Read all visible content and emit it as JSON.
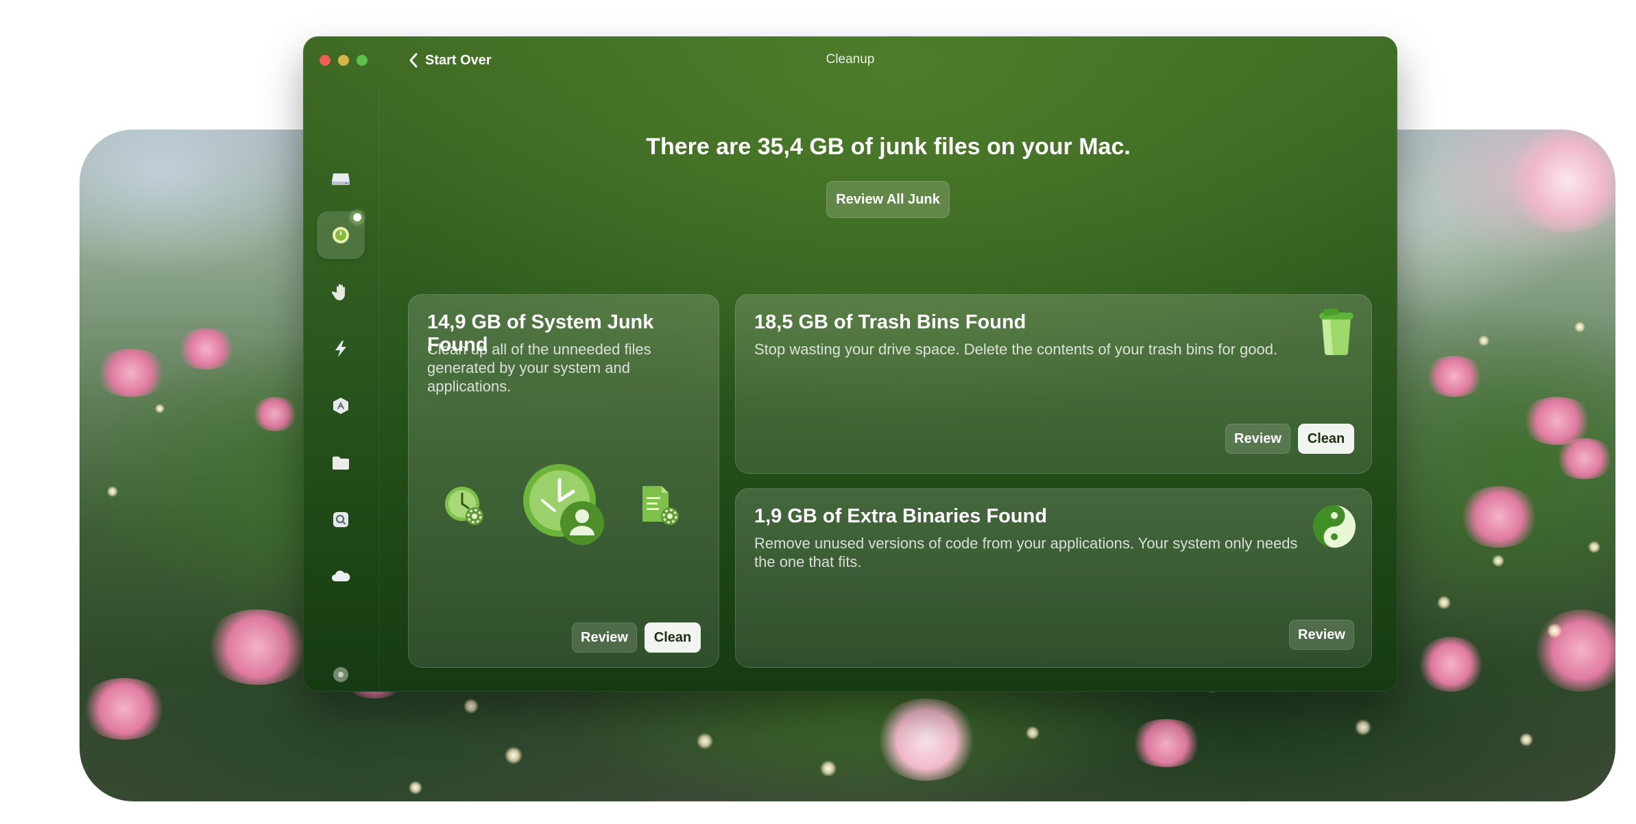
{
  "window": {
    "title": "Cleanup",
    "back_label": "Start Over"
  },
  "sidebar": {
    "items": [
      {
        "name": "sidebar-item-drive",
        "icon": "drive-icon",
        "active": false
      },
      {
        "name": "sidebar-item-cleanup",
        "icon": "cleanup-icon",
        "active": true
      },
      {
        "name": "sidebar-item-protection",
        "icon": "hand-icon",
        "active": false
      },
      {
        "name": "sidebar-item-performance",
        "icon": "lightning-icon",
        "active": false
      },
      {
        "name": "sidebar-item-applications",
        "icon": "apps-icon",
        "active": false
      },
      {
        "name": "sidebar-item-files",
        "icon": "folder-icon",
        "active": false
      },
      {
        "name": "sidebar-item-space-lens",
        "icon": "lens-icon",
        "active": false
      },
      {
        "name": "sidebar-item-cloud",
        "icon": "cloud-icon",
        "active": false
      },
      {
        "name": "sidebar-item-assistant",
        "icon": "assistant-icon",
        "active": false
      }
    ]
  },
  "main": {
    "headline": "There are 35,4 GB of junk files on your Mac.",
    "review_all_label": "Review All Junk",
    "cards": {
      "system_junk": {
        "title": "14,9 GB of System Junk Found",
        "description": "Clean up all of the unneeded files generated by your system and applications.",
        "review_label": "Review",
        "clean_label": "Clean"
      },
      "trash_bins": {
        "title": "18,5 GB of Trash Bins Found",
        "description": "Stop wasting your drive space. Delete the contents of your trash bins for good.",
        "review_label": "Review",
        "clean_label": "Clean"
      },
      "extra_binaries": {
        "title": "1,9 GB of Extra Binaries Found",
        "description": "Remove unused versions of code from your applications. Your system only needs the one that fits.",
        "review_label": "Review"
      }
    }
  },
  "colors": {
    "window_top": "#4e7c2a",
    "window_bottom": "#163a12",
    "accent_icon": "#6dbb3c",
    "button_solid": "#f2f4f0",
    "traffic_red": "#ee5f57",
    "traffic_yellow": "#d8b44a",
    "traffic_green": "#5ec04d"
  }
}
